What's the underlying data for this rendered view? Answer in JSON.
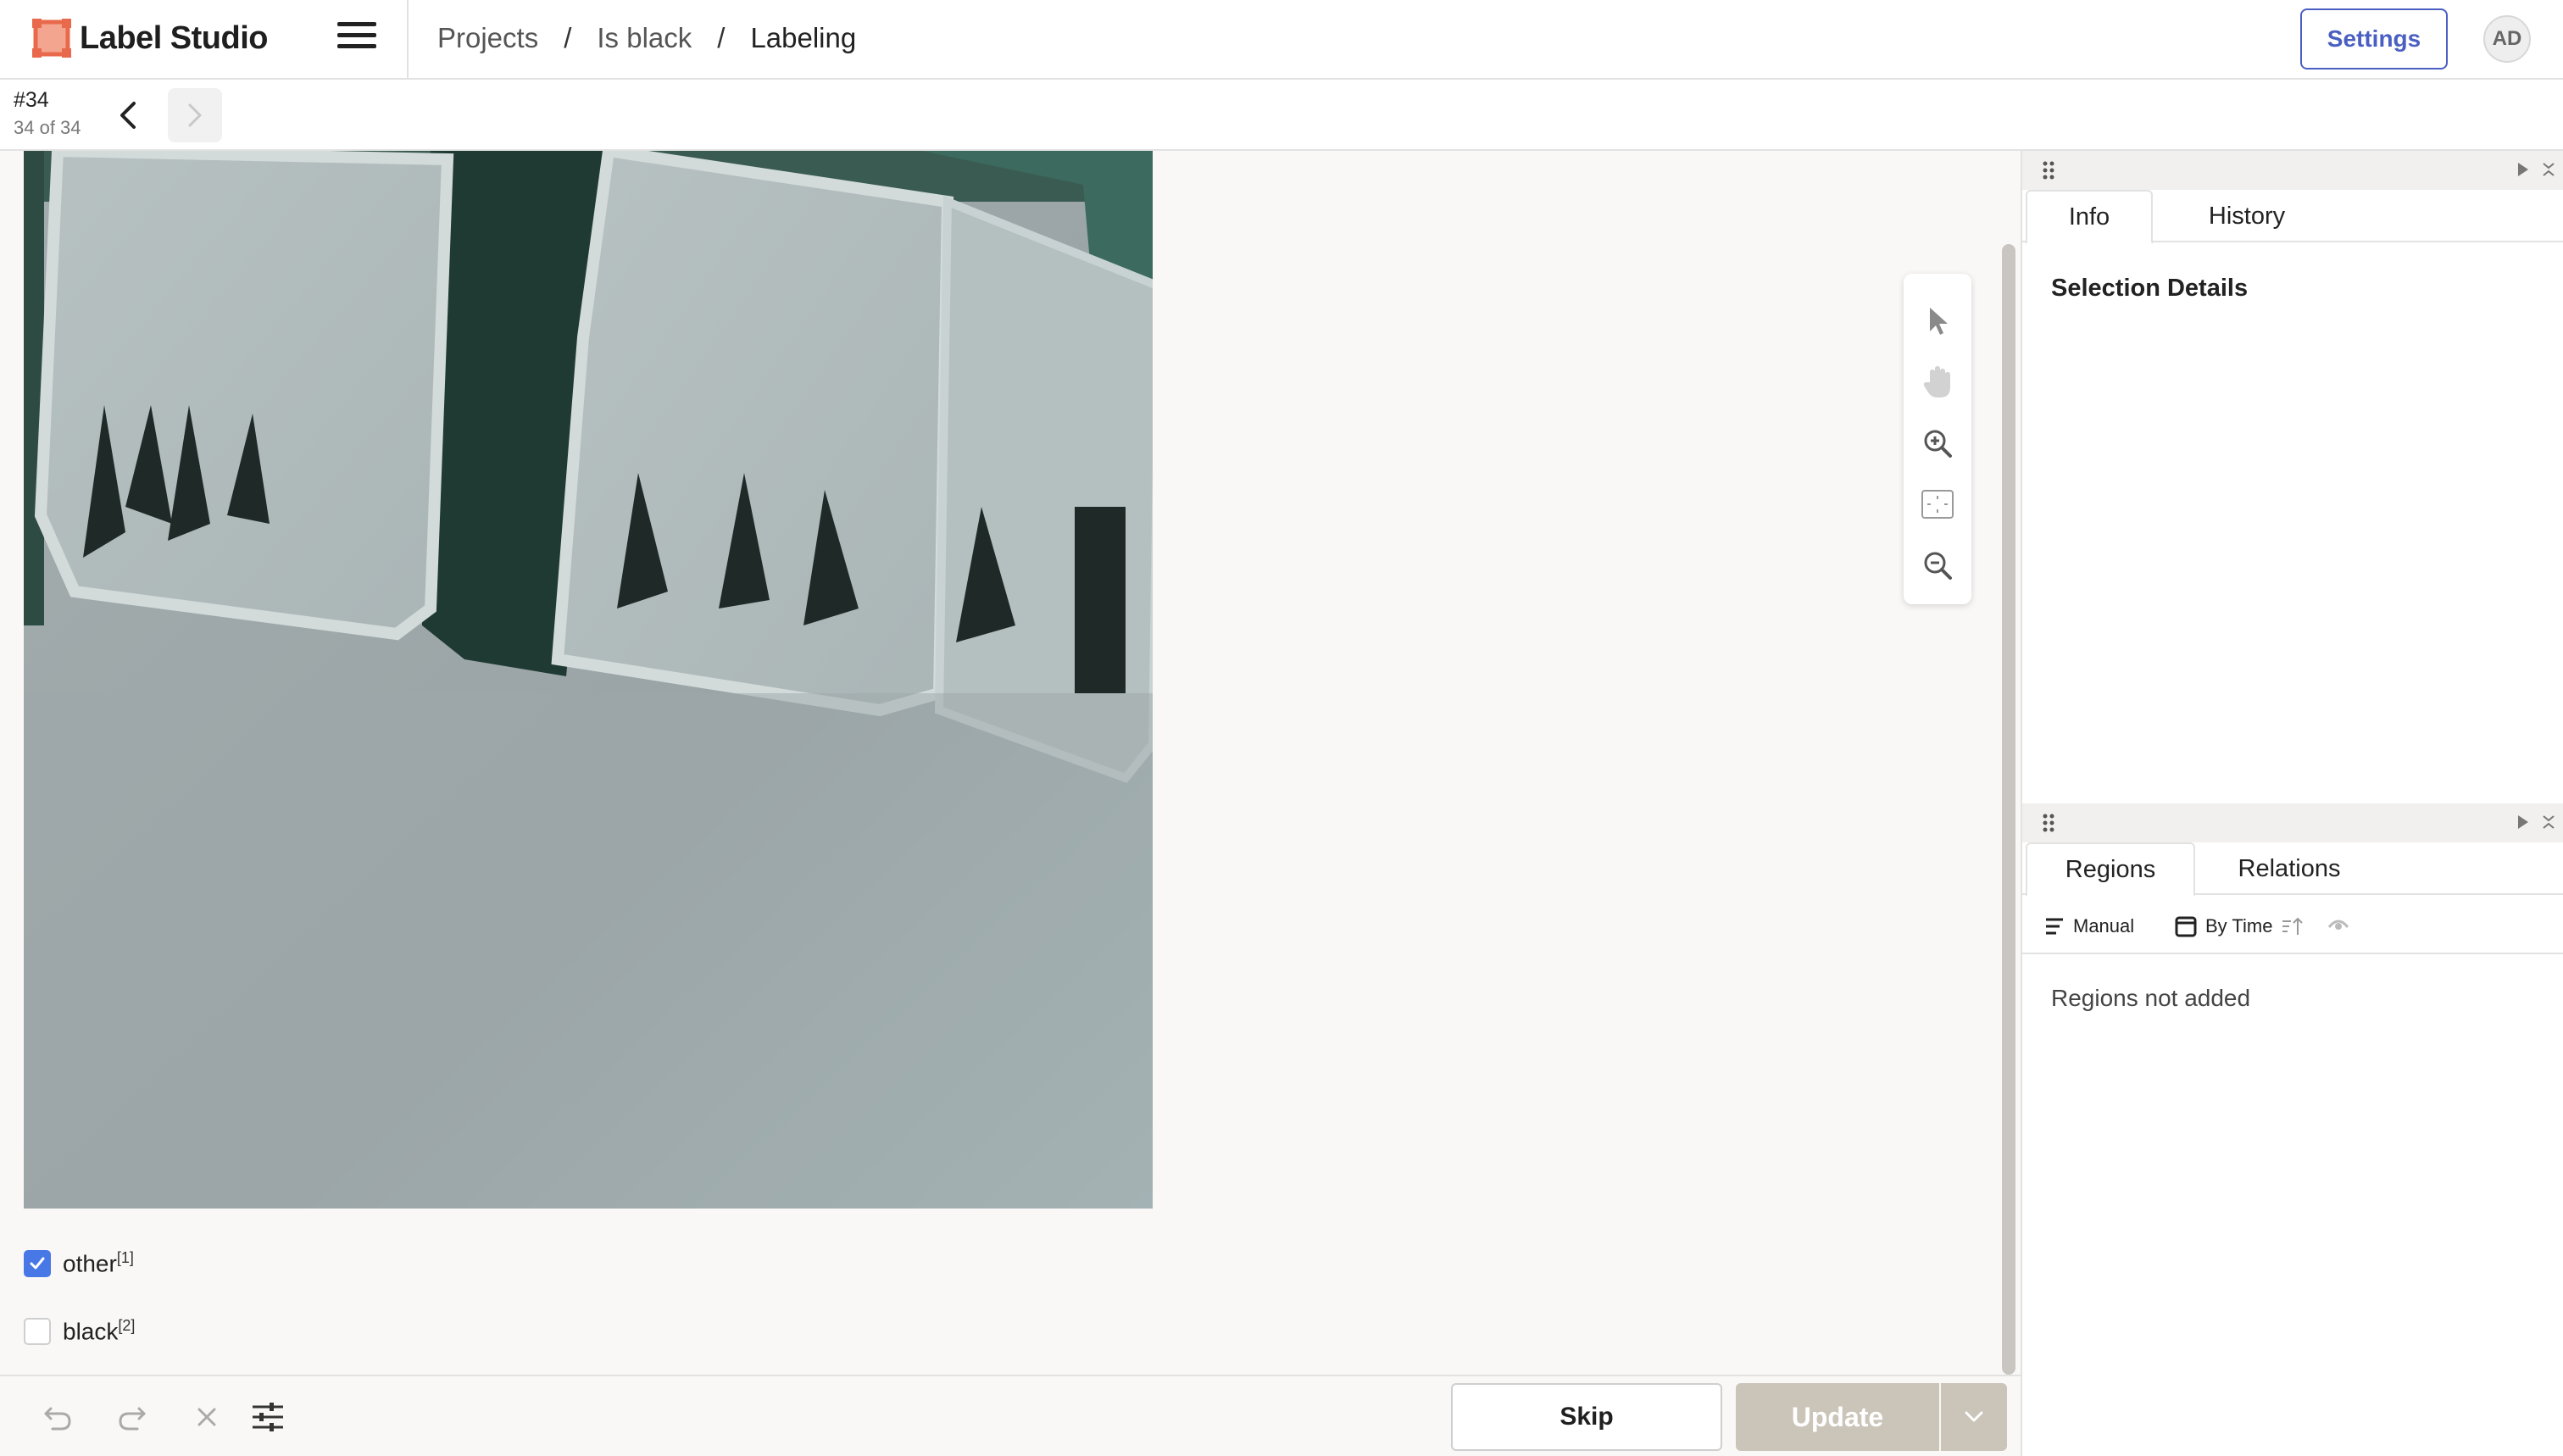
{
  "app": {
    "name": "Label Studio",
    "avatar": "AD",
    "settings_label": "Settings"
  },
  "breadcrumb": {
    "projects": "Projects",
    "project": "Is black",
    "current": "Labeling",
    "sep": "/"
  },
  "task": {
    "id": "#34",
    "count": "34 of 34"
  },
  "choices": [
    {
      "label": "other",
      "hotkey": "[1]",
      "checked": true
    },
    {
      "label": "black",
      "hotkey": "[2]",
      "checked": false
    }
  ],
  "bottom": {
    "skip_label": "Skip",
    "update_label": "Update"
  },
  "side": {
    "tabs_top": [
      "Info",
      "History"
    ],
    "selection_title": "Selection Details",
    "tabs_bottom": [
      "Regions",
      "Relations"
    ],
    "sort_manual": "Manual",
    "sort_time": "By Time",
    "regions_empty": "Regions not added"
  },
  "colors": {
    "accent": "#4a5fc1",
    "logo": "#e8694b",
    "checkbox": "#4778e6",
    "update_disabled": "#cbc4b9"
  }
}
